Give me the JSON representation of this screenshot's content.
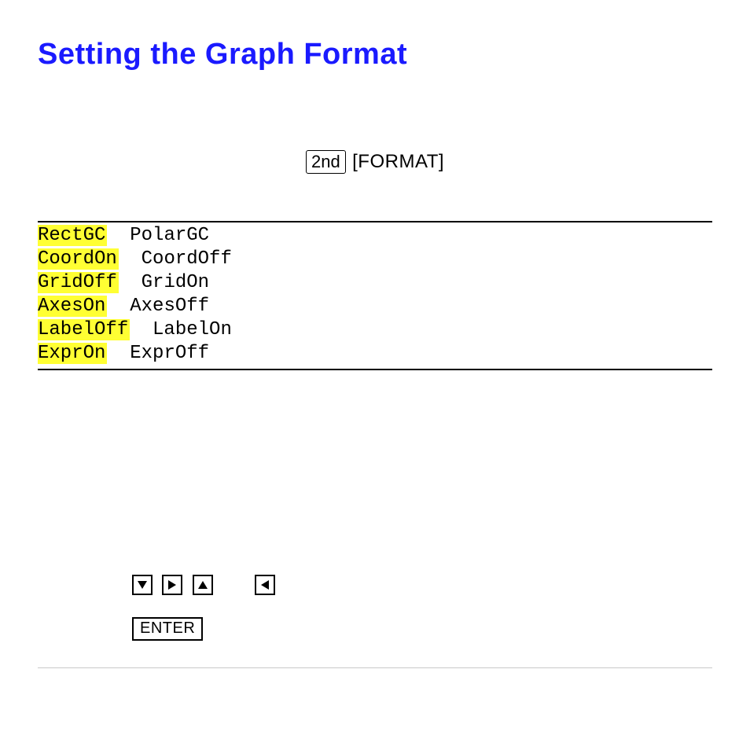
{
  "heading": "Setting the Graph Format",
  "access": {
    "second_key": "2nd",
    "format_label": "[FORMAT]"
  },
  "format_rows": [
    {
      "selected": "RectGC",
      "other": "PolarGC"
    },
    {
      "selected": "CoordOn",
      "other": "CoordOff"
    },
    {
      "selected": "GridOff",
      "other": "GridOn"
    },
    {
      "selected": "AxesOn",
      "other": "AxesOff"
    },
    {
      "selected": "LabelOff",
      "other": "LabelOn"
    },
    {
      "selected": "ExprOn",
      "other": "ExprOff"
    }
  ],
  "enter_key": "ENTER"
}
